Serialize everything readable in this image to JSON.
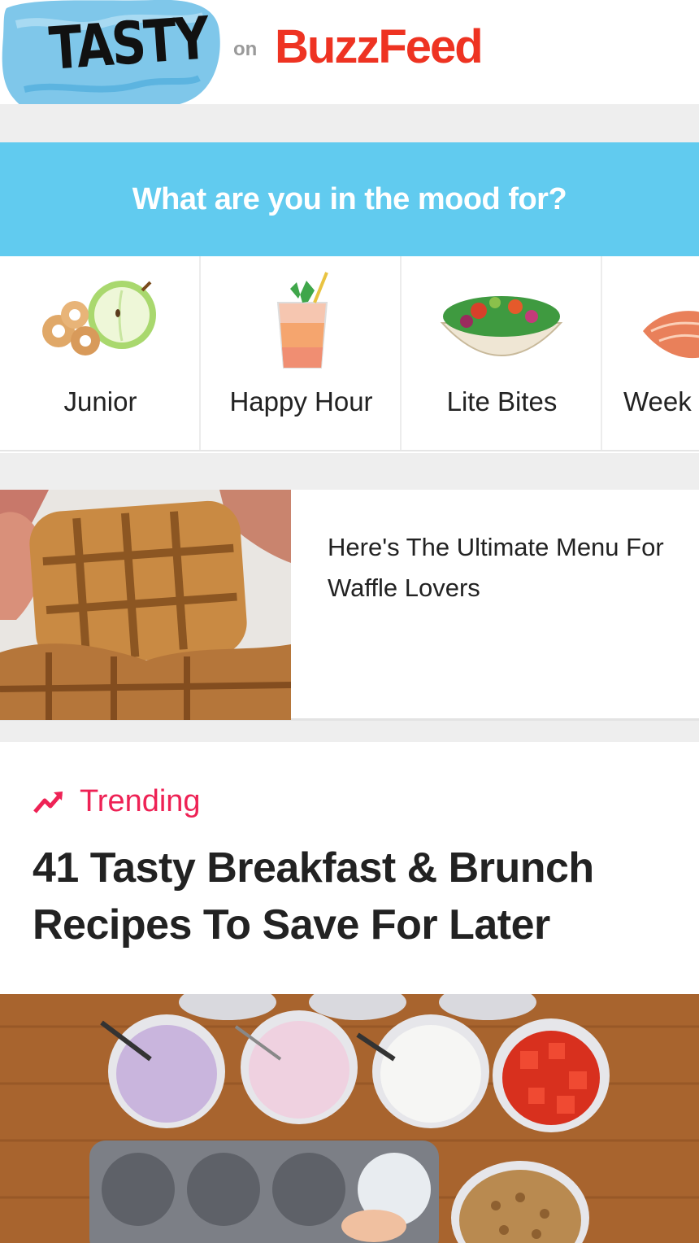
{
  "header": {
    "logo_text": "TASTY",
    "on_text": "on",
    "brand": "BuzzFeed"
  },
  "mood": {
    "title": "What are you in the mood for?"
  },
  "categories": [
    {
      "label": "Junior",
      "icon": "bagel-apple-icon"
    },
    {
      "label": "Happy Hour",
      "icon": "cocktail-icon"
    },
    {
      "label": "Lite Bites",
      "icon": "salad-bowl-icon"
    },
    {
      "label": "Week",
      "icon": "salmon-icon"
    }
  ],
  "article": {
    "title": "Here's The Ultimate Menu For Waffle Lovers"
  },
  "trending": {
    "label": "Trending",
    "title": "41 Tasty Breakfast & Brunch Recipes To Save For Later"
  },
  "colors": {
    "banner": "#61cbef",
    "buzzfeed_red": "#ee3322",
    "trending_pink": "#ee2255"
  }
}
